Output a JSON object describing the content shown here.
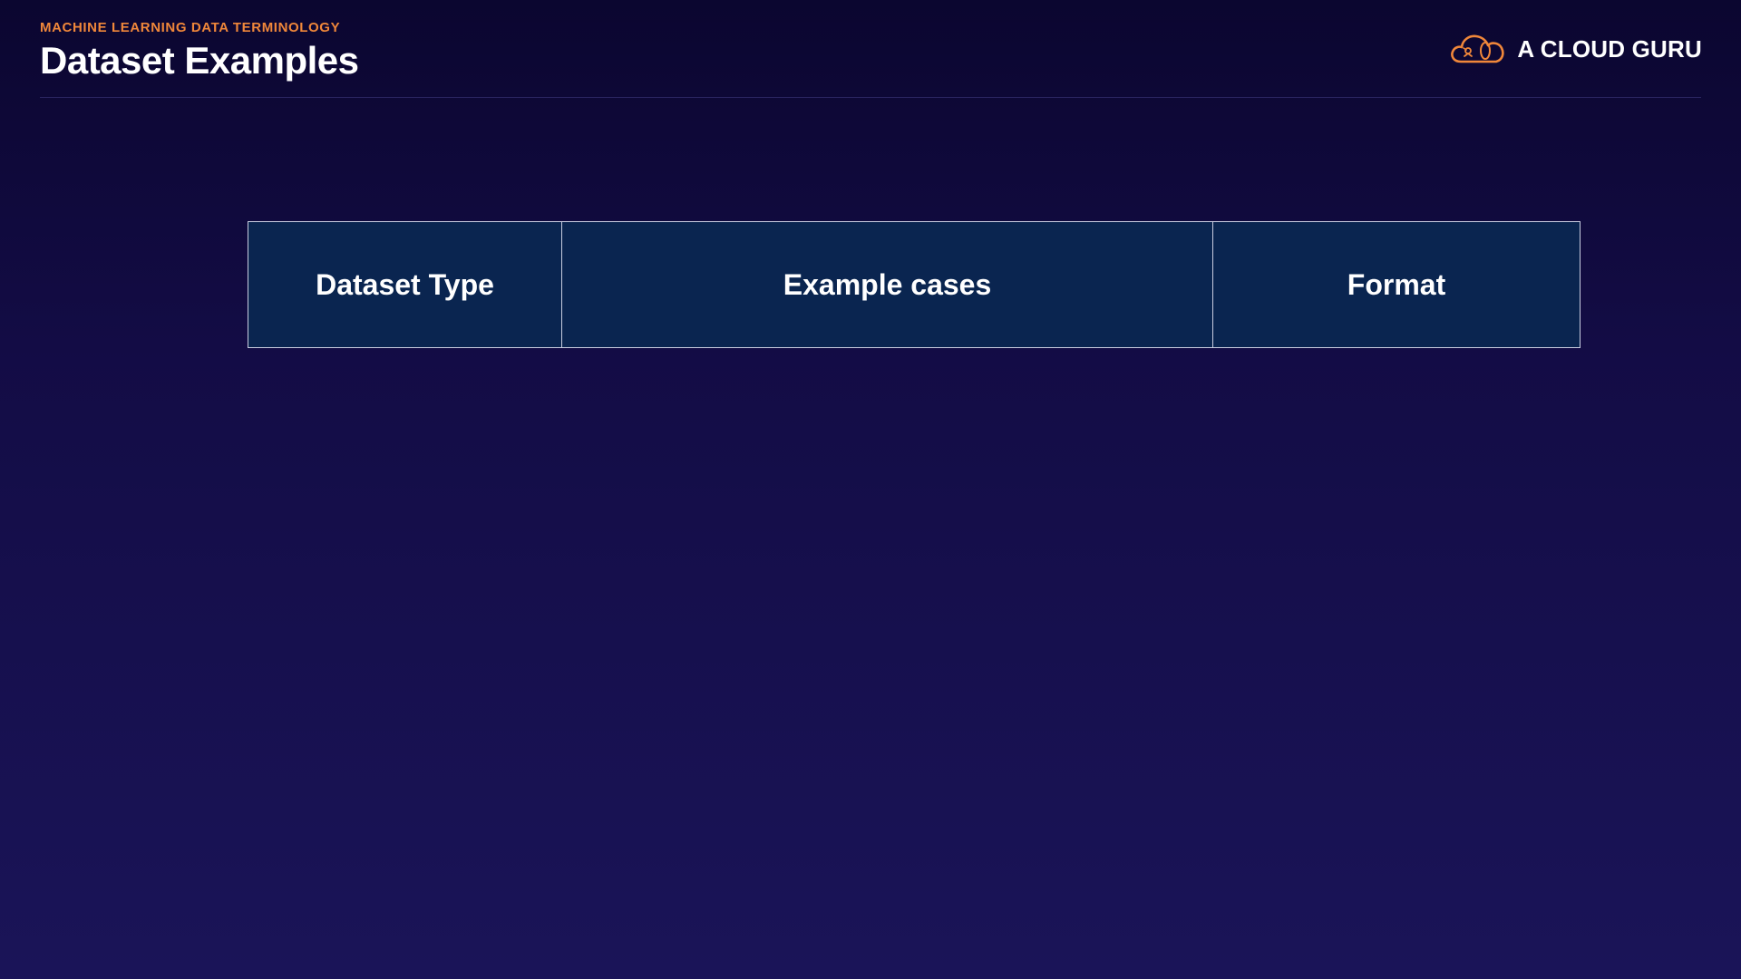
{
  "header": {
    "eyebrow": "MACHINE LEARNING DATA TERMINOLOGY",
    "title": "Dataset Examples"
  },
  "brand": {
    "name": "A CLOUD GURU",
    "icon": "cloud-icon",
    "accent_color": "#f0873a"
  },
  "table": {
    "columns": [
      "Dataset Type",
      "Example cases",
      "Format"
    ],
    "rows": []
  },
  "colors": {
    "background_top": "#0b0630",
    "background_bottom": "#1a1458",
    "header_cell": "#0a2550",
    "accent": "#f0873a"
  }
}
